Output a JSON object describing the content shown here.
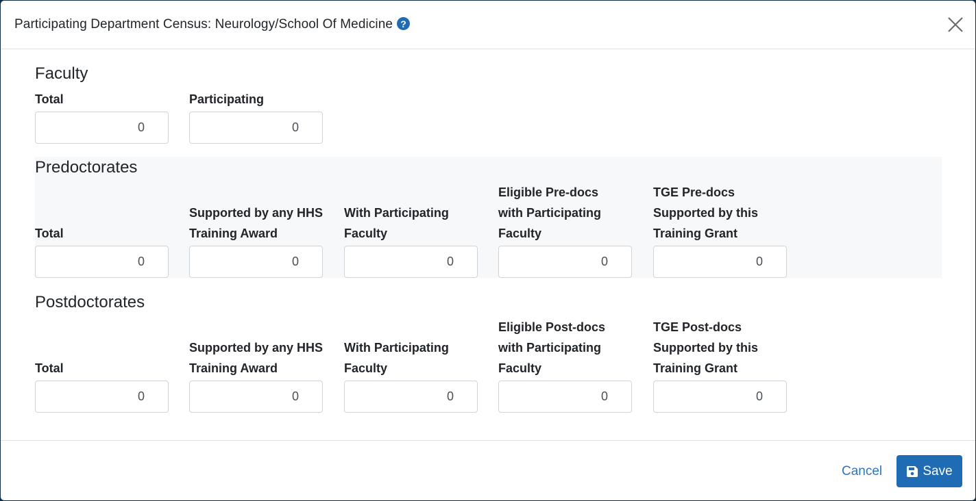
{
  "dialog": {
    "title": "Participating Department Census: Neurology/School Of Medicine",
    "help_icon": "question-circle-icon",
    "close_icon": "close-icon"
  },
  "faculty": {
    "title": "Faculty",
    "fields": [
      {
        "label": "Total",
        "value": "0"
      },
      {
        "label": "Participating",
        "value": "0"
      }
    ]
  },
  "predoctorates": {
    "title": "Predoctorates",
    "fields": [
      {
        "label": "Total",
        "value": "0"
      },
      {
        "label": "Supported by any HHS Training Award",
        "value": "0"
      },
      {
        "label": "With Participating Faculty",
        "value": "0"
      },
      {
        "label": "Eligible Pre-docs with Participating Faculty",
        "value": "0"
      },
      {
        "label": "TGE Pre-docs Supported by this Training Grant",
        "value": "0"
      }
    ]
  },
  "postdoctorates": {
    "title": "Postdoctorates",
    "fields": [
      {
        "label": "Total",
        "value": "0"
      },
      {
        "label": "Supported by any HHS Training Award",
        "value": "0"
      },
      {
        "label": "With Participating Faculty",
        "value": "0"
      },
      {
        "label": "Eligible Post-docs with Participating Faculty",
        "value": "0"
      },
      {
        "label": "TGE Post-docs Supported by this Training Grant",
        "value": "0"
      }
    ]
  },
  "footer": {
    "cancel_label": "Cancel",
    "save_label": "Save",
    "save_icon": "floppy-disk-icon"
  },
  "colors": {
    "primary": "#1f6cb5",
    "link": "#2f76b9",
    "shaded_bg": "#f7f8fa"
  }
}
